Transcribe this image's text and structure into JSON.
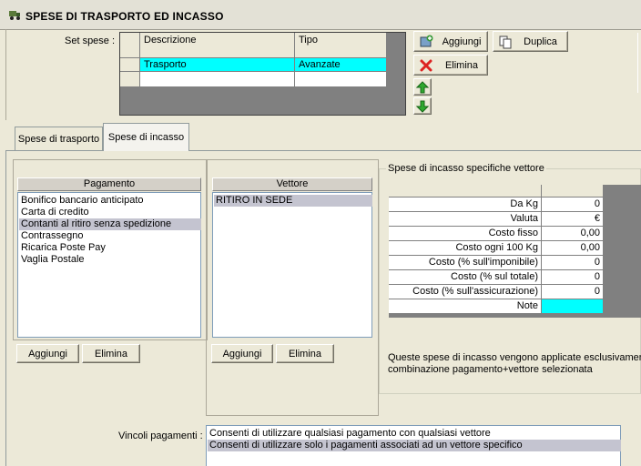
{
  "window": {
    "title": "SPESE DI TRASPORTO ED INCASSO"
  },
  "set_spese": {
    "label": "Set spese :",
    "columns": [
      "Descrizione",
      "Tipo"
    ],
    "rows": [
      {
        "descrizione": "Trasporto",
        "tipo": "Avanzate"
      },
      {
        "descrizione": "",
        "tipo": ""
      }
    ]
  },
  "actions": {
    "aggiungi": "Aggiungi",
    "duplica": "Duplica",
    "elimina": "Elimina"
  },
  "tabs": [
    {
      "label": "Spese di trasporto",
      "active": false
    },
    {
      "label": "Spese di incasso",
      "active": true
    }
  ],
  "pagamento": {
    "header": "Pagamento",
    "items": [
      "Bonifico bancario anticipato",
      "Carta di credito",
      "Contanti al ritiro senza spedizione",
      "Contrassegno",
      "Ricarica Poste Pay",
      "Vaglia Postale"
    ],
    "selected_index": 2,
    "add_label": "Aggiungi",
    "delete_label": "Elimina"
  },
  "vettore": {
    "header": "Vettore",
    "items": [
      "RITIRO IN SEDE"
    ],
    "selected_index": 0,
    "add_label": "Aggiungi",
    "delete_label": "Elimina"
  },
  "specifiche": {
    "group_title": "Spese di incasso specifiche vettore",
    "rows": [
      {
        "label": "Da Kg",
        "value": "0"
      },
      {
        "label": "Valuta",
        "value": "€"
      },
      {
        "label": "Costo fisso",
        "value": "0,00"
      },
      {
        "label": "Costo ogni 100 Kg",
        "value": "0,00"
      },
      {
        "label": "Costo (% sull'imponibile)",
        "value": "0"
      },
      {
        "label": "Costo (% sul totale)",
        "value": "0"
      },
      {
        "label": "Costo (% sull'assicurazione)",
        "value": "0"
      },
      {
        "label": "Note",
        "value": ""
      }
    ],
    "note_line1": "Queste spese di incasso vengono applicate esclusivamente",
    "note_line2": "combinazione pagamento+vettore selezionata"
  },
  "vincoli": {
    "label": "Vincoli pagamenti :",
    "options": [
      "Consenti di utilizzare qualsiasi pagamento con qualsiasi vettore",
      "Consenti di utilizzare solo i pagamenti associati ad un vettore specifico"
    ],
    "selected_index": 1
  },
  "colors": {
    "selection_cyan": "#00ffff",
    "list_selection": "#c4c4d0",
    "grid_dark": "#808080"
  }
}
